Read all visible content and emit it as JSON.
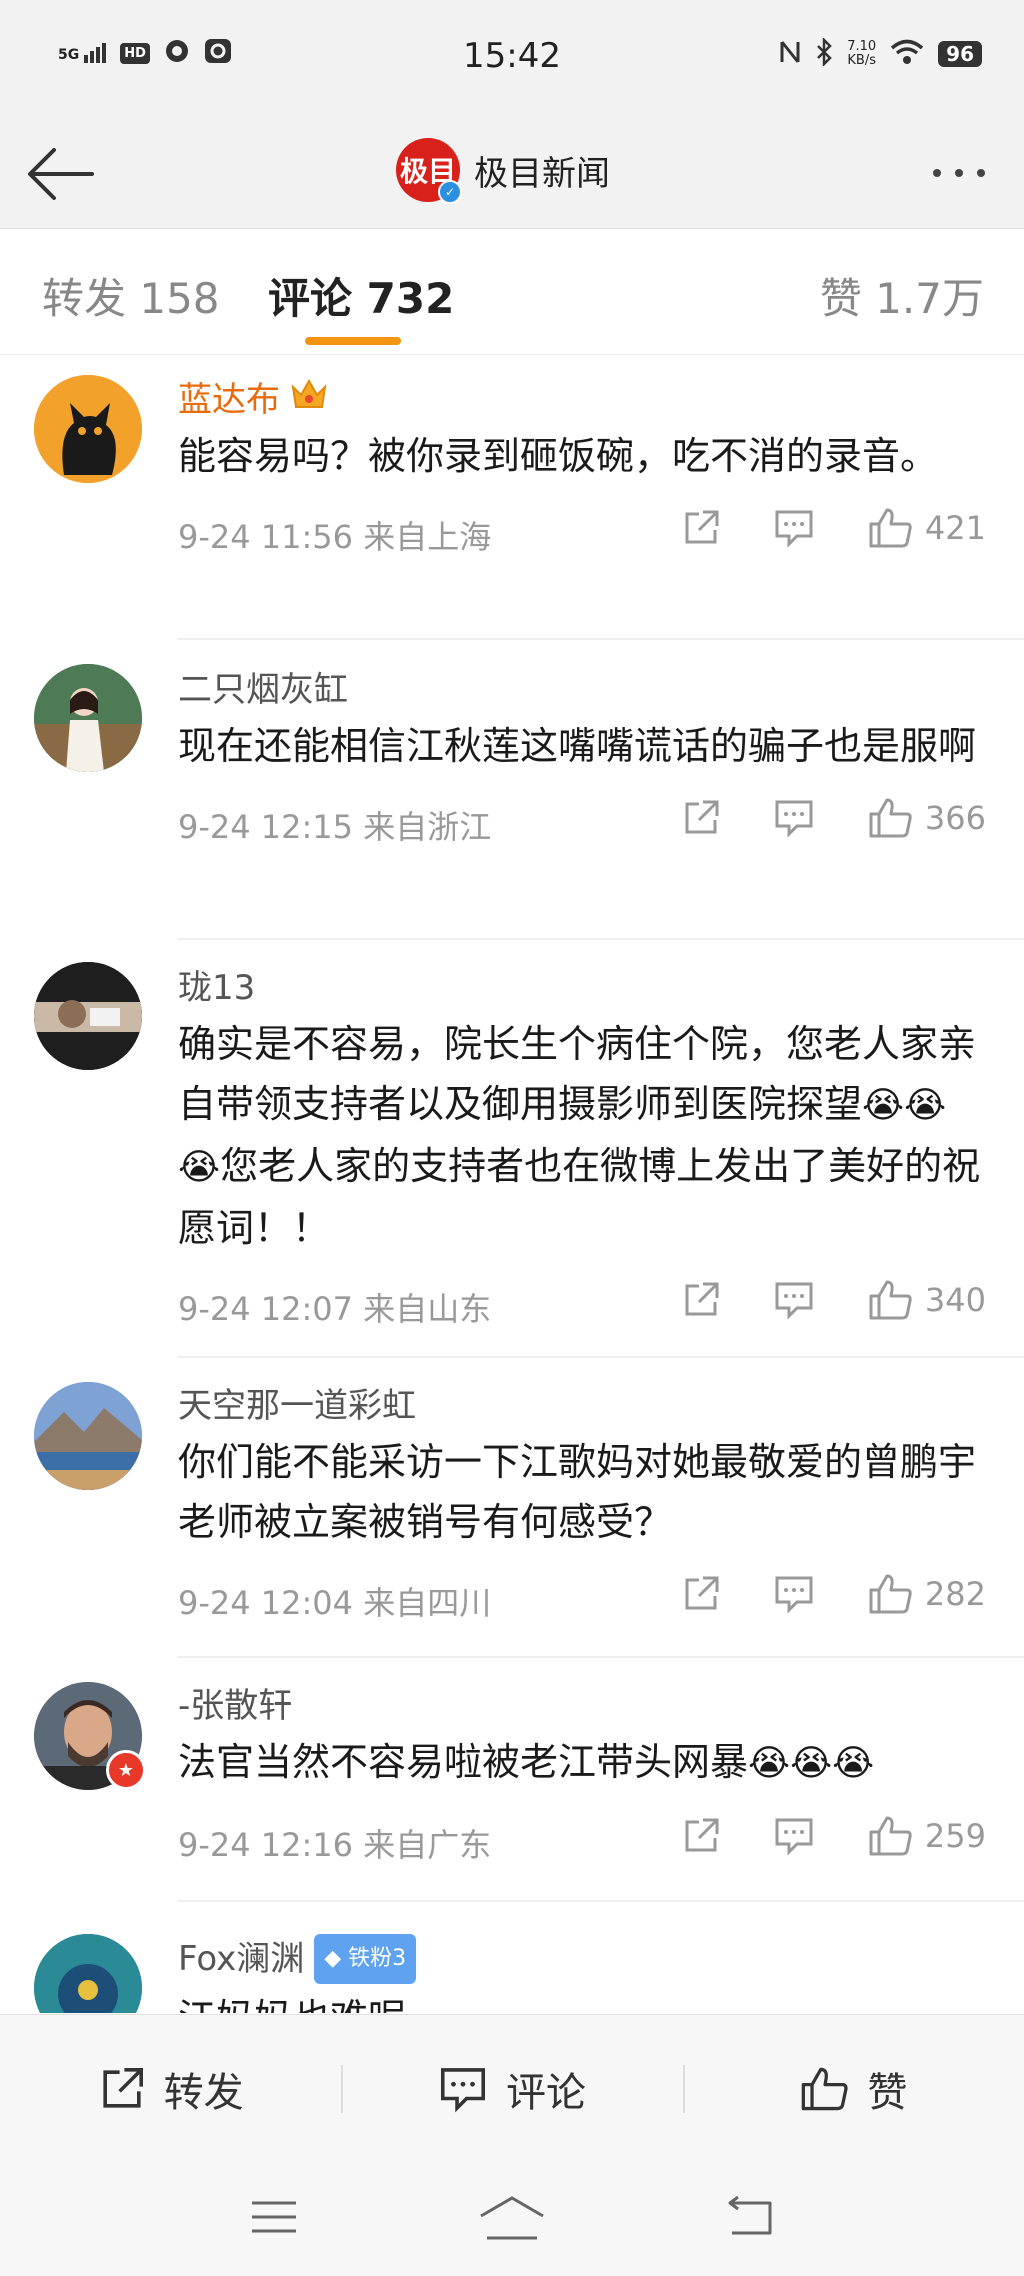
{
  "status_bar": {
    "signal": "5G",
    "hd": "HD",
    "time": "15:42",
    "net_speed_value": "7.10",
    "net_speed_unit": "KB/s",
    "battery": "96"
  },
  "header": {
    "logo_text": "极目",
    "account_name": "极目新闻"
  },
  "tabs": [
    {
      "label": "转发 158"
    },
    {
      "label": "评论 732"
    },
    {
      "label": "赞 1.7万"
    }
  ],
  "comments": [
    {
      "user": "蓝达布",
      "text": "能容易吗？被你录到砸饭碗，吃不消的录音。",
      "time": "9-24 11:56 来自上海",
      "likes": "421"
    },
    {
      "user": "二只烟灰缸",
      "text": "现在还能相信江秋莲这嘴嘴谎话的骗子也是服啊",
      "time": "9-24 12:15 来自浙江",
      "likes": "366"
    },
    {
      "user": "珑13",
      "text": "确实是不容易，院长生个病住个院，您老人家亲自带领支持者以及御用摄影师到医院探望",
      "text_after": "您老人家的支持者也在微博上发出了美好的祝愿词！！",
      "emojis": "😭😭😭",
      "time": "9-24 12:07 来自山东",
      "likes": "340"
    },
    {
      "user": "天空那一道彩虹",
      "text": "你们能不能采访一下江歌妈对她最敬爱的曾鹏宇老师被立案被销号有何感受？",
      "time": "9-24 12:04 来自四川",
      "likes": "282"
    },
    {
      "user": "-张散轩",
      "text": "法官当然不容易啦被老江带头网暴",
      "emojis": "😭😭😭",
      "time": "9-24 12:16 来自广东",
      "likes": "259"
    },
    {
      "user": "Fox澜渊",
      "badge": "铁粉3",
      "text": "江妈妈也难呢"
    }
  ],
  "bottom_bar": {
    "repost": "转发",
    "comment": "评论",
    "like": "赞"
  },
  "colors": {
    "accent": "#f5940e",
    "username_vip": "#e86b0c",
    "brand_red": "#d9211c",
    "fan_badge": "#5fa3f0"
  }
}
